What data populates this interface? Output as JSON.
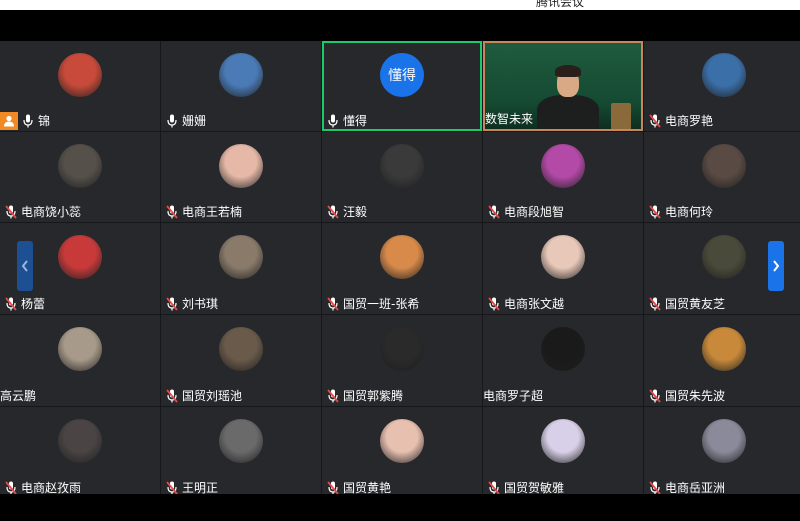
{
  "window": {
    "title": "腾讯会议"
  },
  "participants": [
    {
      "name": "锦",
      "host": true,
      "mic": "on",
      "avatar_color": "#c84a3a"
    },
    {
      "name": "姗姗",
      "mic": "on",
      "avatar_color": "#4a7bb7"
    },
    {
      "name": "懂得",
      "mic": "on",
      "speaking": true,
      "avatar_text": "懂得",
      "avatar_color": "#1a73e8"
    },
    {
      "name": "数智未来",
      "video": true
    },
    {
      "name": "电商罗艳",
      "mic": "muted",
      "avatar_color": "#3b6fa8"
    },
    {
      "name": "电商饶小蕊",
      "mic": "muted",
      "avatar_color": "#55504a"
    },
    {
      "name": "电商王若楠",
      "mic": "muted",
      "avatar_color": "#e6b8a8"
    },
    {
      "name": "汪毅",
      "mic": "muted",
      "avatar_color": "#3a3a3a"
    },
    {
      "name": "电商段旭智",
      "mic": "muted",
      "avatar_color": "#b44aa8"
    },
    {
      "name": "电商何玲",
      "mic": "muted",
      "avatar_color": "#5a4a44"
    },
    {
      "name": "杨蕾",
      "mic": "muted",
      "avatar_color": "#c83a3a"
    },
    {
      "name": "刘书琪",
      "mic": "muted",
      "avatar_color": "#8a7a6a"
    },
    {
      "name": "国贸一班-张希",
      "mic": "muted",
      "avatar_color": "#d88a4a"
    },
    {
      "name": "电商张文越",
      "mic": "muted",
      "avatar_color": "#e8c8b8"
    },
    {
      "name": "国贸黄友芝",
      "mic": "muted",
      "avatar_color": "#4a4a3a"
    },
    {
      "name": "高云鹏",
      "mic": "none",
      "avatar_color": "#a89a8a"
    },
    {
      "name": "国贸刘瑶池",
      "mic": "muted",
      "avatar_color": "#6a5a4a"
    },
    {
      "name": "国贸郭紫腾",
      "mic": "muted",
      "avatar_color": "#2a2a2a"
    },
    {
      "name": "电商罗子超",
      "mic": "none",
      "avatar_color": "#1a1a1a"
    },
    {
      "name": "国贸朱先波",
      "mic": "muted",
      "avatar_color": "#c88a3a"
    },
    {
      "name": "电商赵孜雨",
      "mic": "muted",
      "avatar_color": "#4a4444"
    },
    {
      "name": "王明正",
      "mic": "muted",
      "avatar_color": "#6a6a6a"
    },
    {
      "name": "国贸黄艳",
      "mic": "muted",
      "avatar_color": "#e8c0b0"
    },
    {
      "name": "国贸贺敏雅",
      "mic": "muted",
      "avatar_color": "#d8d0e8"
    },
    {
      "name": "电商岳亚洲",
      "mic": "muted",
      "avatar_color": "#8a8a9a"
    }
  ],
  "colors": {
    "speaking_border": "#1ec96b",
    "muted_mic": "#e54b4b",
    "host_badge": "#f08a24",
    "page_button": "#1a73e8"
  },
  "icons": {
    "mic_on": "microphone-icon",
    "mic_muted": "microphone-muted-icon",
    "host": "host-person-icon",
    "prev": "chevron-left-icon",
    "next": "chevron-right-icon"
  }
}
